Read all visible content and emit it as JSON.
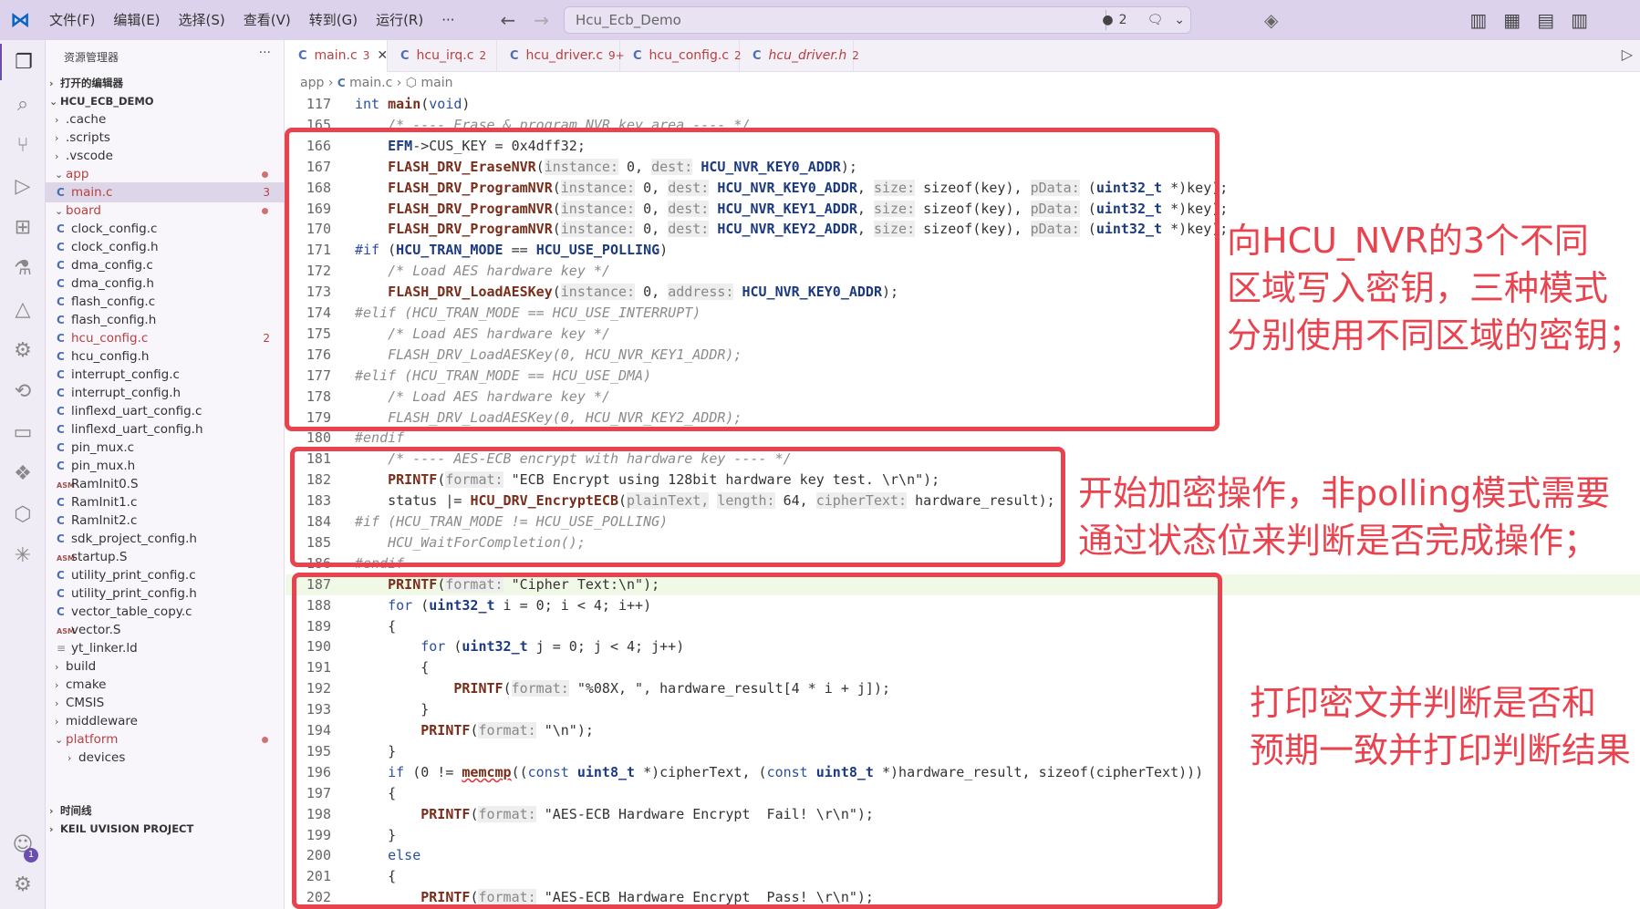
{
  "titlebar": {
    "menus": [
      "文件(F)",
      "编辑(E)",
      "选择(S)",
      "查看(V)",
      "转到(G)",
      "运行(R)",
      "···"
    ],
    "search_text": "Hcu_Ecb_Demo",
    "problems_count": "2"
  },
  "sidebar": {
    "header": "资源管理器",
    "open_editors": "打开的编辑器",
    "workspace": "HCU_ECB_DEMO",
    "items": [
      {
        "label": ".cache",
        "type": "folder"
      },
      {
        "label": ".scripts",
        "type": "folder"
      },
      {
        "label": ".vscode",
        "type": "folder"
      },
      {
        "label": "app",
        "type": "folder-open"
      },
      {
        "label": "main.c",
        "type": "c",
        "count": "3"
      },
      {
        "label": "board",
        "type": "folder-open"
      },
      {
        "label": "clock_config.c",
        "type": "c"
      },
      {
        "label": "clock_config.h",
        "type": "c"
      },
      {
        "label": "dma_config.c",
        "type": "c"
      },
      {
        "label": "dma_config.h",
        "type": "c"
      },
      {
        "label": "flash_config.c",
        "type": "c"
      },
      {
        "label": "flash_config.h",
        "type": "c"
      },
      {
        "label": "hcu_config.c",
        "type": "c",
        "count": "2"
      },
      {
        "label": "hcu_config.h",
        "type": "c"
      },
      {
        "label": "interrupt_config.c",
        "type": "c"
      },
      {
        "label": "interrupt_config.h",
        "type": "c"
      },
      {
        "label": "linflexd_uart_config.c",
        "type": "c"
      },
      {
        "label": "linflexd_uart_config.h",
        "type": "c"
      },
      {
        "label": "pin_mux.c",
        "type": "c"
      },
      {
        "label": "pin_mux.h",
        "type": "c"
      },
      {
        "label": "RamInit0.S",
        "type": "asm"
      },
      {
        "label": "RamInit1.c",
        "type": "c"
      },
      {
        "label": "RamInit2.c",
        "type": "c"
      },
      {
        "label": "sdk_project_config.h",
        "type": "c"
      },
      {
        "label": "startup.S",
        "type": "asm"
      },
      {
        "label": "utility_print_config.c",
        "type": "c"
      },
      {
        "label": "utility_print_config.h",
        "type": "c"
      },
      {
        "label": "vector_table_copy.c",
        "type": "c"
      },
      {
        "label": "vector.S",
        "type": "asm"
      },
      {
        "label": "yt_linker.ld",
        "type": "ld"
      },
      {
        "label": "build",
        "type": "folder"
      },
      {
        "label": "cmake",
        "type": "folder"
      },
      {
        "label": "CMSIS",
        "type": "folder"
      },
      {
        "label": "middleware",
        "type": "folder"
      },
      {
        "label": "platform",
        "type": "folder-open"
      },
      {
        "label": "devices",
        "type": "folder"
      }
    ],
    "timeline": "时间线",
    "keil": "KEIL UVISION PROJECT"
  },
  "tabs": [
    {
      "label": "main.c",
      "count": "3"
    },
    {
      "label": "hcu_irq.c",
      "count": "2"
    },
    {
      "label": "hcu_driver.c",
      "count": "9+"
    },
    {
      "label": "hcu_config.c",
      "count": "2"
    },
    {
      "label": "hcu_driver.h",
      "count": "2"
    }
  ],
  "breadcrumb": {
    "a": "app",
    "b": "main.c",
    "c": "main"
  },
  "editor": {
    "lines": [
      {
        "n": "117",
        "html": "<span class=\"kw\">int</span> <span class=\"fn\">main</span>(<span class=\"kw\">void</span>)"
      },
      {
        "n": "165",
        "html": "    <span class=\"cm\">/* ---- Erase &amp; program NVR key area ---- */</span>"
      },
      {
        "n": "166",
        "html": "    <span class=\"mac\">EFM</span>-&gt;CUS_KEY = 0x4dff32;"
      },
      {
        "n": "167",
        "html": "    <span class=\"fn\">FLASH_DRV_EraseNVR</span>(<span class=\"ih\">instance:</span> 0, <span class=\"ih\">dest:</span> <span class=\"mac\">HCU_NVR_KEY0_ADDR</span>);"
      },
      {
        "n": "168",
        "html": "    <span class=\"fn\">FLASH_DRV_ProgramNVR</span>(<span class=\"ih\">instance:</span> 0, <span class=\"ih\">dest:</span> <span class=\"mac\">HCU_NVR_KEY0_ADDR</span>, <span class=\"ih\">size:</span> sizeof(key), <span class=\"ih\">pData:</span> (<span class=\"ty\">uint32_t</span> *)key);"
      },
      {
        "n": "169",
        "html": "    <span class=\"fn\">FLASH_DRV_ProgramNVR</span>(<span class=\"ih\">instance:</span> 0, <span class=\"ih\">dest:</span> <span class=\"mac\">HCU_NVR_KEY1_ADDR</span>, <span class=\"ih\">size:</span> sizeof(key), <span class=\"ih\">pData:</span> (<span class=\"ty\">uint32_t</span> *)key);"
      },
      {
        "n": "170",
        "html": "    <span class=\"fn\">FLASH_DRV_ProgramNVR</span>(<span class=\"ih\">instance:</span> 0, <span class=\"ih\">dest:</span> <span class=\"mac\">HCU_NVR_KEY2_ADDR</span>, <span class=\"ih\">size:</span> sizeof(key), <span class=\"ih\">pData:</span> (<span class=\"ty\">uint32_t</span> *)key);"
      },
      {
        "n": "171",
        "html": "<span class=\"kw\">#if</span> (<span class=\"mac\">HCU_TRAN_MODE</span> == <span class=\"mac\">HCU_USE_POLLING</span>)"
      },
      {
        "n": "172",
        "html": "    <span class=\"cm\">/* Load AES hardware key */</span>"
      },
      {
        "n": "173",
        "html": "    <span class=\"fn\">FLASH_DRV_LoadAESKey</span>(<span class=\"ih\">instance:</span> 0, <span class=\"ih\">address:</span> <span class=\"mac\">HCU_NVR_KEY0_ADDR</span>);"
      },
      {
        "n": "174",
        "html": "<span class=\"cm\">#elif (HCU_TRAN_MODE == HCU_USE_INTERRUPT)</span>"
      },
      {
        "n": "175",
        "html": "    <span class=\"cm\">/* Load AES hardware key */</span>"
      },
      {
        "n": "176",
        "html": "    <span class=\"cm\">FLASH_DRV_LoadAESKey(0, HCU_NVR_KEY1_ADDR);</span>"
      },
      {
        "n": "177",
        "html": "<span class=\"cm\">#elif (HCU_TRAN_MODE == HCU_USE_DMA)</span>"
      },
      {
        "n": "178",
        "html": "    <span class=\"cm\">/* Load AES hardware key */</span>"
      },
      {
        "n": "179",
        "html": "    <span class=\"cm\">FLASH_DRV_LoadAESKey(0, HCU_NVR_KEY2_ADDR);</span>"
      },
      {
        "n": "180",
        "html": "<span class=\"cm\">#endif</span>"
      },
      {
        "n": "181",
        "html": "    <span class=\"cm\">/* ---- AES-ECB encrypt with hardware key ---- */</span>"
      },
      {
        "n": "182",
        "html": "    <span class=\"fn\">PRINTF</span>(<span class=\"ih\">format:</span> \"ECB Encrypt using 128bit hardware key test. \\r\\n\");"
      },
      {
        "n": "183",
        "html": "    status |= <span class=\"fn\">HCU_DRV_EncryptECB</span>(<span class=\"ih\">plainText,</span> <span class=\"ih\">length:</span> 64, <span class=\"ih\">cipherText:</span> hardware_result);"
      },
      {
        "n": "184",
        "html": "<span class=\"cm\">#if (HCU_TRAN_MODE != HCU_USE_POLLING)</span>"
      },
      {
        "n": "185",
        "html": "    <span class=\"cm\">HCU_WaitForCompletion();</span>"
      },
      {
        "n": "186",
        "html": "<span class=\"cm\">#endif</span>"
      },
      {
        "n": "187",
        "html": "    <span class=\"fn\">PRINTF</span>(<span class=\"ih\">format:</span> \"Cipher Text:\\n\");"
      },
      {
        "n": "188",
        "html": "    <span class=\"kw\">for</span> (<span class=\"ty\">uint32_t</span> i = 0; i &lt; 4; i++)"
      },
      {
        "n": "189",
        "html": "    {"
      },
      {
        "n": "190",
        "html": "        <span class=\"kw\">for</span> (<span class=\"ty\">uint32_t</span> j = 0; j &lt; 4; j++)"
      },
      {
        "n": "191",
        "html": "        {"
      },
      {
        "n": "192",
        "html": "            <span class=\"fn\">PRINTF</span>(<span class=\"ih\">format:</span> \"%08X, \", hardware_result[4 * i + j]);"
      },
      {
        "n": "193",
        "html": "        }"
      },
      {
        "n": "194",
        "html": "        <span class=\"fn\">PRINTF</span>(<span class=\"ih\">format:</span> \"\\n\");"
      },
      {
        "n": "195",
        "html": "    }"
      },
      {
        "n": "196",
        "html": "    <span class=\"kw\">if</span> (0 != <span class=\"fn\" style=\"text-decoration:underline wavy #d33;\">memcmp</span>((<span class=\"kw\">const</span> <span class=\"ty\">uint8_t</span> *)cipherText, (<span class=\"kw\">const</span> <span class=\"ty\">uint8_t</span> *)hardware_result, sizeof(cipherText)))"
      },
      {
        "n": "197",
        "html": "    {"
      },
      {
        "n": "198",
        "html": "        <span class=\"fn\">PRINTF</span>(<span class=\"ih\">format:</span> \"AES-ECB Hardware Encrypt  Fail! \\r\\n\");"
      },
      {
        "n": "199",
        "html": "    }"
      },
      {
        "n": "200",
        "html": "    <span class=\"kw\">else</span>"
      },
      {
        "n": "201",
        "html": "    {"
      },
      {
        "n": "202",
        "html": "        <span class=\"fn\">PRINTF</span>(<span class=\"ih\">format:</span> \"AES-ECB Hardware Encrypt  Pass! \\r\\n\");"
      }
    ]
  },
  "annotations": {
    "note1": [
      "向HCU_NVR的3个不同",
      "区域写入密钥，三种模式",
      "分别使用不同区域的密钥；"
    ],
    "note2": [
      "开始加密操作，非polling模式需要",
      "通过状态位来判断是否完成操作；"
    ],
    "note3": [
      "打印密文并判断是否和",
      "预期一致并打印判断结果"
    ],
    "color": "#e8434f"
  }
}
